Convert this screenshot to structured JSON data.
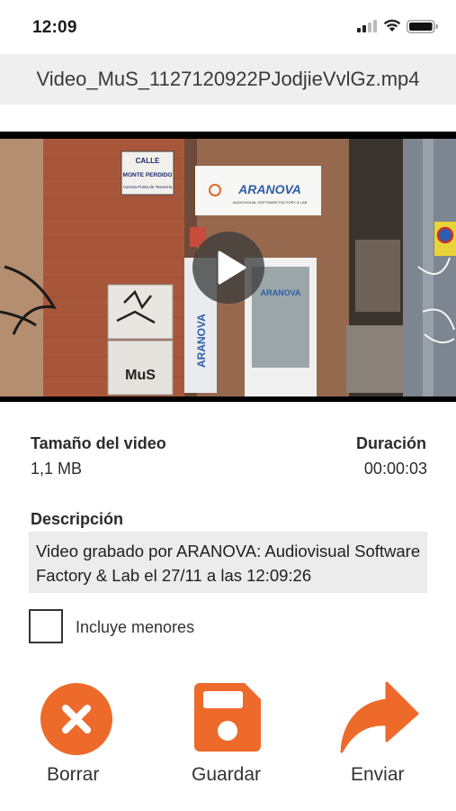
{
  "status_bar": {
    "time": "12:09"
  },
  "file": {
    "name": "Video_MuS_1127120922PJodjieVvlGz.mp4"
  },
  "video": {
    "scene": {
      "street_sign": {
        "line1": "CALLE",
        "line2": "MONTE PERDIDO",
        "line3": "Carrera Punta de Tesorería"
      },
      "company_sign": {
        "name": "ARANOVA",
        "tagline": "AUDIOVISUAL SOFTWARE FACTORY & LAB"
      },
      "vertical_banner": "ARANOVA",
      "door_text": "ARANOVA",
      "graffiti": "MuS"
    }
  },
  "info": {
    "size_label": "Tamaño del video",
    "size_value": "1,1 MB",
    "duration_label": "Duración",
    "duration_value": "00:00:03",
    "description_label": "Descripción",
    "description_text": "Video grabado por ARANOVA: Audiovisual Software Factory & Lab el 27/11 a las 12:09:26",
    "minors_label": "Incluye menores",
    "minors_checked": false
  },
  "actions": [
    {
      "label": "Borrar",
      "icon": "delete-x-icon"
    },
    {
      "label": "Guardar",
      "icon": "floppy-save-icon"
    },
    {
      "label": "Enviar",
      "icon": "share-arrow-icon"
    }
  ],
  "colors": {
    "accent": "#ed6a2b",
    "field_bg": "#ececec"
  }
}
